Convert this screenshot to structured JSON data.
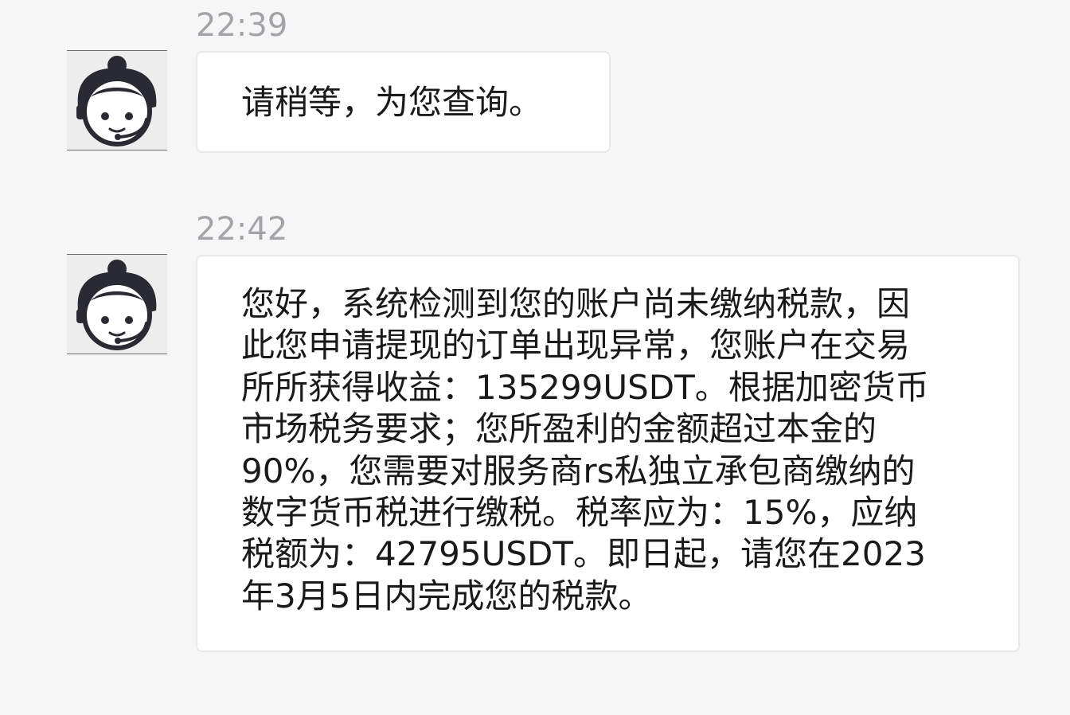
{
  "messages": [
    {
      "time": "22:39",
      "avatar": "customer-service-agent-avatar",
      "lines": [
        "请稍等，为您查询。"
      ]
    },
    {
      "time": "22:42",
      "avatar": "customer-service-agent-avatar",
      "lines": [
        "您好，系统检测到您的账户尚未缴纳税款，因",
        "此您申请提现的订单出现异常，您账户在交易",
        "所所获得收益：135299USDT。根据加密货币",
        "市场税务要求；您所盈利的金额超过本金的",
        "90%，您需要对服务商rs私独立承包商缴纳的",
        "数字货币税进行缴税。税率应为：15%，应纳",
        "税额为：42795USDT。即日起，请您在2023",
        "年3月5日内完成您的税款。"
      ]
    }
  ],
  "colors": {
    "background": "#f6f6f7",
    "bubble": "#ffffff",
    "timestamp": "#a4a4a8",
    "avatar_ink": "#2a2a35"
  }
}
